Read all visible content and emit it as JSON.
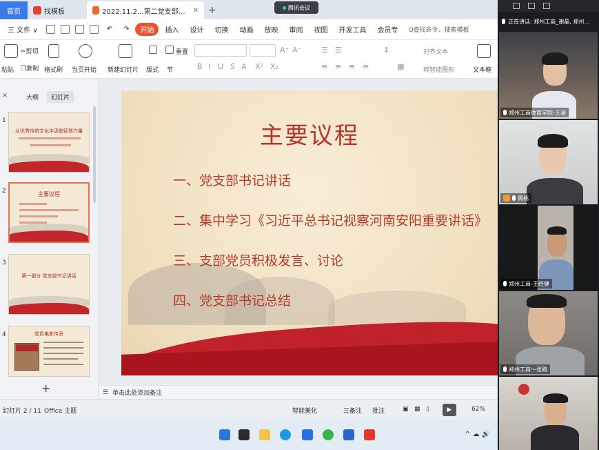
{
  "tabs": {
    "home": "首页",
    "template": "找模板",
    "doc": "2022.11.2...第二党支部组织生活",
    "close": "✕",
    "new": "+"
  },
  "meeting": {
    "label": "腾讯会议"
  },
  "menu": {
    "file": "三 文件 ∨",
    "items": [
      "开始",
      "插入",
      "设计",
      "切换",
      "动画",
      "放映",
      "审阅",
      "视图",
      "开发工具",
      "会员专"
    ],
    "search": "Q查找命令、搜索模板"
  },
  "ribbon": {
    "paste": "粘贴",
    "cut": "剪切",
    "copy": "复制",
    "format_painter": "格式刷",
    "start_from_current": "当页开始",
    "new_slide": "新建幻灯片",
    "layout": "版式",
    "section": "节",
    "reset": "重置",
    "align_text": "对齐文本",
    "convert_smartart": "转智能图形",
    "textbox": "文本框",
    "format_buttons": [
      "B",
      "I",
      "U",
      "S",
      "A",
      "X²",
      "X₂"
    ]
  },
  "left_panel": {
    "close": "×",
    "tab_outline": "大纲",
    "tab_slides": "幻灯片",
    "add": "+",
    "thumbs": [
      {
        "num": "1",
        "title": "从优秀传统文化中汲取智慧力量"
      },
      {
        "num": "2",
        "title": "主要议程"
      },
      {
        "num": "3",
        "title": "第一部分 党支部书记讲话"
      },
      {
        "num": "4",
        "title": "党员电影传承"
      }
    ]
  },
  "slide": {
    "title": "主要议程",
    "agenda": [
      "一、党支部书记讲话",
      "二、集中学习《习近平总书记视察河南安阳重要讲话》",
      "三、支部党员积极发言、讨论",
      "四、党支部书记总结"
    ]
  },
  "notes": {
    "placeholder": "单击此处添加备注"
  },
  "status": {
    "slide_count": "幻灯片 2 / 11",
    "theme": "Office 主题",
    "smart_beautify": "智能美化",
    "notes": "三备注",
    "comments": "批注",
    "zoom": "62%"
  },
  "video_panel": {
    "speaking": "正在讲话: 郑州工商_谢晶, 郑州...",
    "participants": [
      {
        "name": "郑州工商体育学院-王涵"
      },
      {
        "name": "周桃"
      },
      {
        "name": "郑州工商-王经健"
      },
      {
        "name": "郑州工商～张路"
      },
      {
        "name": ""
      }
    ]
  },
  "colors": {
    "accent_active": "#e8562f",
    "slide_red": "#c0212a",
    "title_red": "#b5352a",
    "home_blue": "#3b7be8"
  }
}
